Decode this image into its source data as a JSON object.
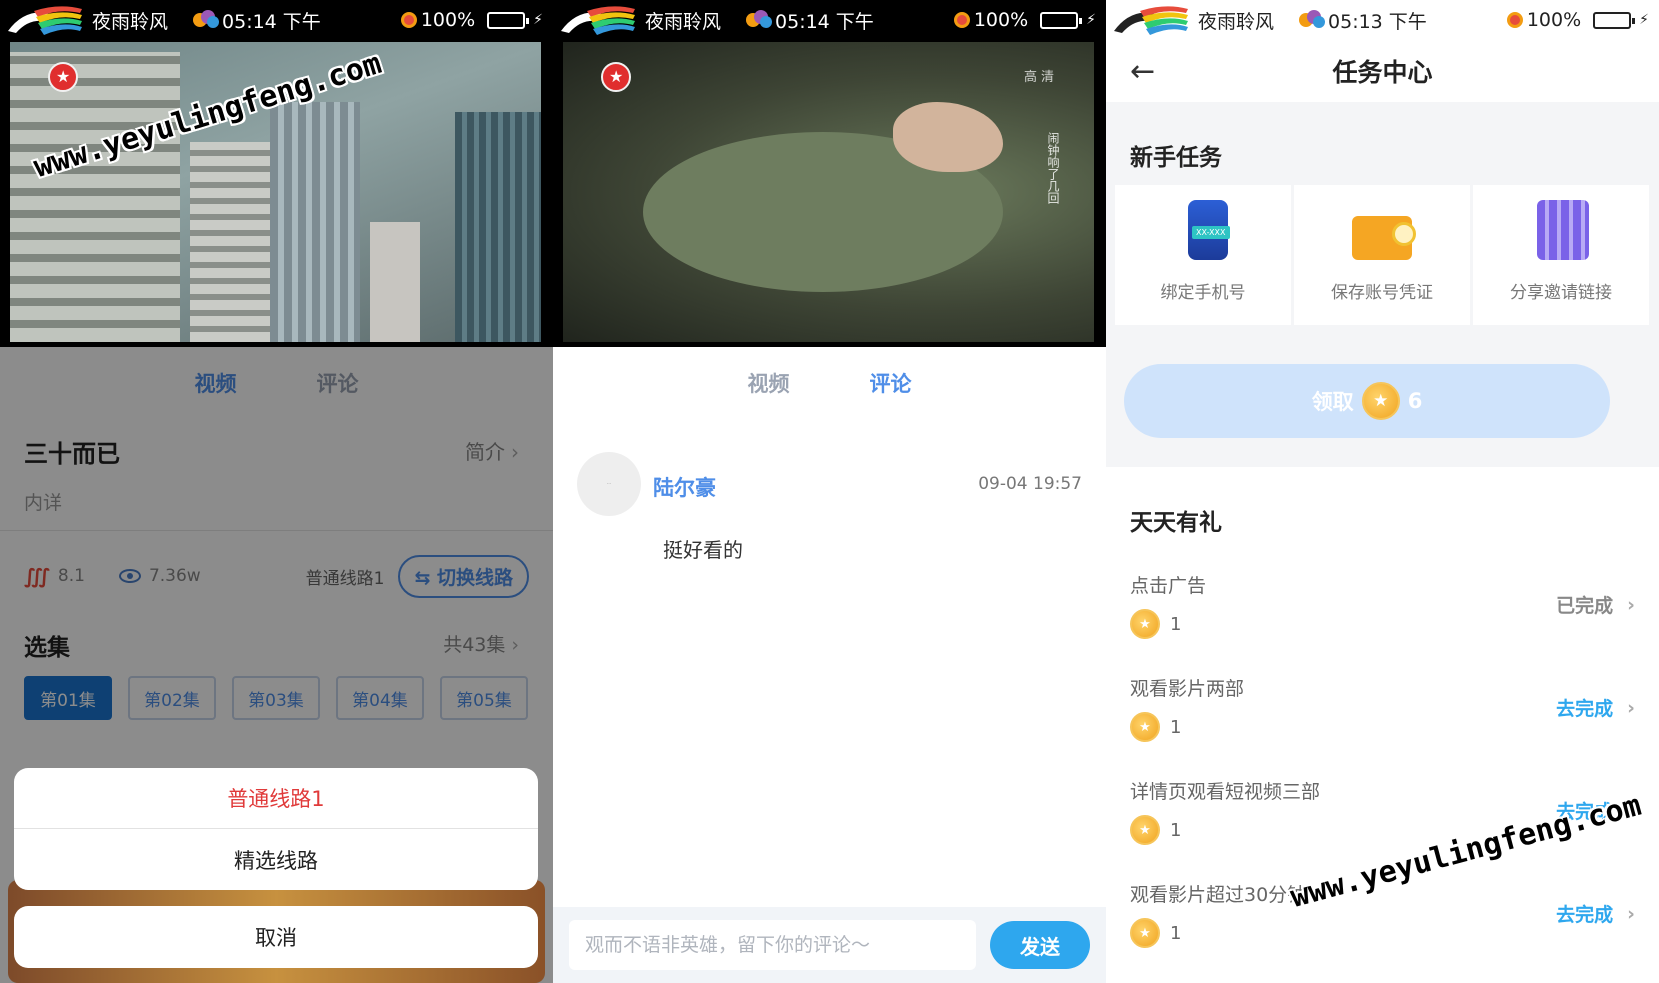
{
  "status": {
    "app_name": "夜雨聆风",
    "battery": "100%",
    "time_p1": "05:14 下午",
    "time_p2": "05:14 下午",
    "time_p3": "05:13 下午"
  },
  "watermark": "www.yeyulingfeng.com",
  "player2": {
    "hd_label": "高清",
    "subtitle": "闹钟响了几回"
  },
  "tabs": {
    "video": "视频",
    "comment": "评论"
  },
  "detail": {
    "title": "三十而已",
    "intro_link": "简介",
    "description": "内详",
    "score": "8.1",
    "views": "7.36w",
    "current_line": "普通线路1",
    "switch_line": "切换线路",
    "select_label": "选集",
    "total_label": "共43集",
    "episodes": [
      "第01集",
      "第02集",
      "第03集",
      "第04集",
      "第05集"
    ]
  },
  "line_sheet": {
    "options": [
      "普通线路1",
      "精选线路"
    ],
    "cancel": "取消"
  },
  "comments": {
    "items": [
      {
        "user": "陆尔豪",
        "time": "09-04 19:57",
        "text": "挺好看的"
      }
    ],
    "placeholder": "观而不语非英雄，留下你的评论～",
    "send": "发送"
  },
  "task_center": {
    "back": "←",
    "title": "任务中心",
    "newbie_title": "新手任务",
    "newbie_tasks": [
      {
        "label": "绑定手机号",
        "icon": "phone-icon"
      },
      {
        "label": "保存账号凭证",
        "icon": "certificate-icon"
      },
      {
        "label": "分享邀请链接",
        "icon": "qr-code-icon"
      }
    ],
    "claim_label": "领取",
    "claim_amount": "6",
    "daily_title": "天天有礼",
    "daily_tasks": [
      {
        "name": "点击广告",
        "reward": "1",
        "action": "已完成",
        "done": true
      },
      {
        "name": "观看影片两部",
        "reward": "1",
        "action": "去完成",
        "done": false
      },
      {
        "name": "详情页观看短视频三部",
        "reward": "1",
        "action": "去完成",
        "done": false
      },
      {
        "name": "观看影片超过30分钟",
        "reward": "1",
        "action": "去完成",
        "done": false
      }
    ]
  },
  "colors": {
    "accent": "#4f8ee8",
    "send_button": "#2ea7ee",
    "selected_line": "#e03a3a",
    "episode_active": "#1b76d1"
  }
}
